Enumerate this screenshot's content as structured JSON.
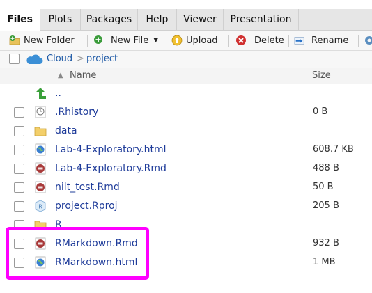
{
  "tabs": [
    {
      "label": "Files",
      "active": true
    },
    {
      "label": "Plots"
    },
    {
      "label": "Packages"
    },
    {
      "label": "Help"
    },
    {
      "label": "Viewer"
    },
    {
      "label": "Presentation"
    }
  ],
  "toolbar": {
    "new_folder": "New Folder",
    "new_file": "New File",
    "upload": "Upload",
    "delete": "Delete",
    "rename": "Rename"
  },
  "breadcrumb": {
    "root": "Cloud",
    "separator": ">",
    "current": "project"
  },
  "table": {
    "col_name": "Name",
    "col_size": "Size",
    "sort_indicator": "▲"
  },
  "files": [
    {
      "name": "..",
      "size": "",
      "icon": "up-arrow-icon"
    },
    {
      "name": ".Rhistory",
      "size": "0 B",
      "icon": "history-icon"
    },
    {
      "name": "data",
      "size": "",
      "icon": "folder-icon"
    },
    {
      "name": "Lab-4-Exploratory.html",
      "size": "608.7 KB",
      "icon": "html-globe-icon"
    },
    {
      "name": "Lab-4-Exploratory.Rmd",
      "size": "488 B",
      "icon": "rmd-icon"
    },
    {
      "name": "nilt_test.Rmd",
      "size": "50 B",
      "icon": "rmd-icon"
    },
    {
      "name": "project.Rproj",
      "size": "205 B",
      "icon": "rproj-icon"
    },
    {
      "name": "R",
      "size": "",
      "icon": "folder-icon"
    },
    {
      "name": "RMarkdown.Rmd",
      "size": "932 B",
      "icon": "rmd-icon"
    },
    {
      "name": "RMarkdown.html",
      "size": "1 MB",
      "icon": "html-globe-icon"
    }
  ],
  "colors": {
    "highlight": "#ff00ff",
    "link": "#1f3c9a"
  }
}
